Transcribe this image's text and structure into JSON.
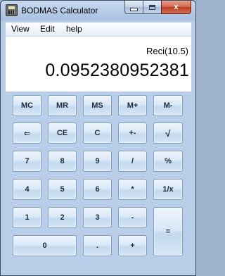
{
  "window": {
    "title": "BODMAS Calculator",
    "controls": {
      "minimize": "minimize",
      "maximize": "maximize",
      "close": "x"
    }
  },
  "menu": {
    "items": [
      "View",
      "Edit",
      "help"
    ]
  },
  "display": {
    "expression": "Reci(10.5)",
    "result": "0.0952380952381"
  },
  "keys": {
    "mc": "MC",
    "mr": "MR",
    "ms": "MS",
    "mplus": "M+",
    "mminus": "M-",
    "backspace": "⇐",
    "ce": "CE",
    "c": "C",
    "plusminus": "+-",
    "sqrt": "√",
    "d7": "7",
    "d8": "8",
    "d9": "9",
    "divide": "/",
    "percent": "%",
    "d4": "4",
    "d5": "5",
    "d6": "6",
    "multiply": "*",
    "reciprocal": "1/x",
    "d1": "1",
    "d2": "2",
    "d3": "3",
    "minus": "-",
    "equals": "=",
    "d0": "0",
    "dot": ".",
    "plus": "+"
  },
  "colors": {
    "title_bg": "#b9cee9",
    "button_border": "#7d9cc2",
    "close_button": "#c24a2e",
    "display_bg": "#ffffff"
  }
}
